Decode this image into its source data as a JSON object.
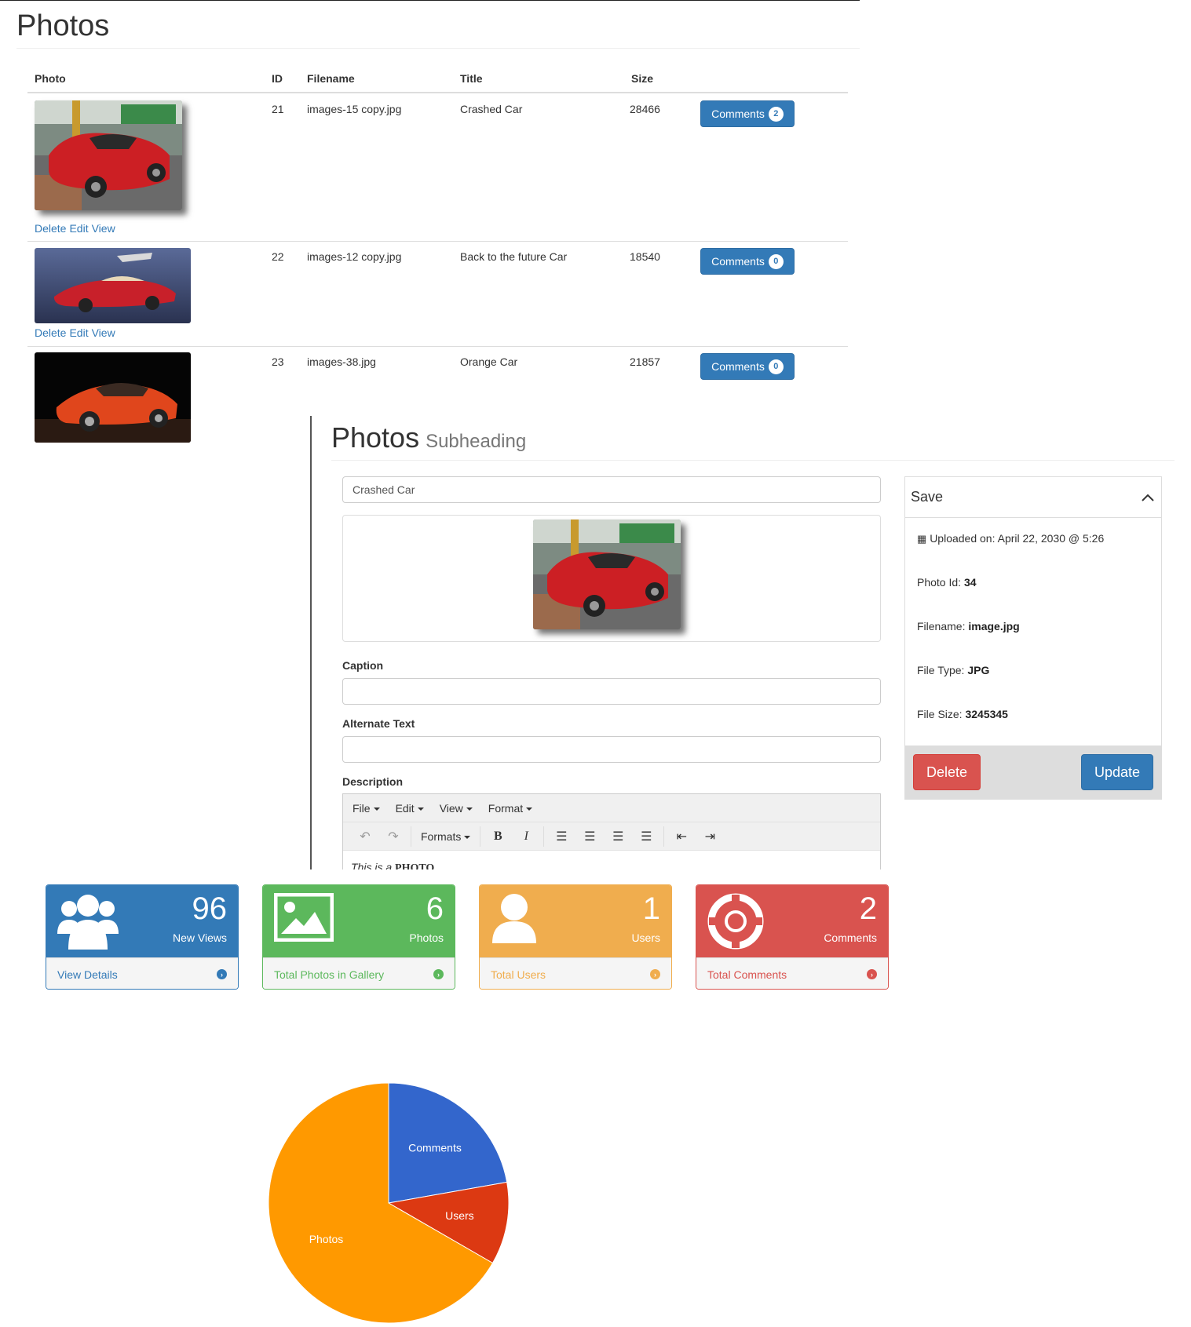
{
  "page": {
    "title": "Photos"
  },
  "table": {
    "headers": [
      "Photo",
      "ID",
      "Filename",
      "Title",
      "Size"
    ],
    "rows": [
      {
        "id": "21",
        "filename": "images-15 copy.jpg",
        "title": "Crashed Car",
        "size": "28466",
        "comments_label": "Comments",
        "comments_count": "2",
        "actions": [
          "Delete",
          "Edit",
          "View"
        ]
      },
      {
        "id": "22",
        "filename": "images-12 copy.jpg",
        "title": "Back to the future Car",
        "size": "18540",
        "comments_label": "Comments",
        "comments_count": "0",
        "actions": [
          "Delete",
          "Edit",
          "View"
        ]
      },
      {
        "id": "23",
        "filename": "images-38.jpg",
        "title": "Orange Car",
        "size": "21857",
        "comments_label": "Comments",
        "comments_count": "0"
      }
    ]
  },
  "edit": {
    "title": "Photos",
    "subheading": "Subheading",
    "title_value": "Crashed Car",
    "caption_label": "Caption",
    "alt_label": "Alternate Text",
    "description_label": "Description",
    "editor": {
      "menus": [
        "File",
        "Edit",
        "View",
        "Format"
      ],
      "formats_label": "Formats",
      "body_prefix": "This is a ",
      "body_bold": "PHOTO"
    }
  },
  "sidebar": {
    "title": "Save",
    "uploaded_label": "Uploaded on:",
    "uploaded_value": "April 22, 2030 @ 5:26",
    "photo_id_label": "Photo Id:",
    "photo_id_value": "34",
    "filename_label": "Filename:",
    "filename_value": "image.jpg",
    "filetype_label": "File Type:",
    "filetype_value": "JPG",
    "filesize_label": "File Size:",
    "filesize_value": "3245345",
    "delete_label": "Delete",
    "update_label": "Update"
  },
  "cards": [
    {
      "value": "96",
      "label": "New Views",
      "footer": "View Details",
      "color": "#337ab7",
      "icon": "users-icon"
    },
    {
      "value": "6",
      "label": "Photos",
      "footer": "Total Photos in Gallery",
      "color": "#5cb85c",
      "icon": "picture-icon"
    },
    {
      "value": "1",
      "label": "Users",
      "footer": "Total Users",
      "color": "#f0ad4e",
      "icon": "user-icon"
    },
    {
      "value": "2",
      "label": "Comments",
      "footer": "Total Comments",
      "color": "#d9534f",
      "icon": "life-ring-icon"
    }
  ],
  "chart_data": {
    "type": "pie",
    "categories": [
      "Comments",
      "Users",
      "Photos"
    ],
    "values": [
      2,
      1,
      6
    ],
    "colors": [
      "#3366cc",
      "#dc3912",
      "#ff9900"
    ]
  }
}
